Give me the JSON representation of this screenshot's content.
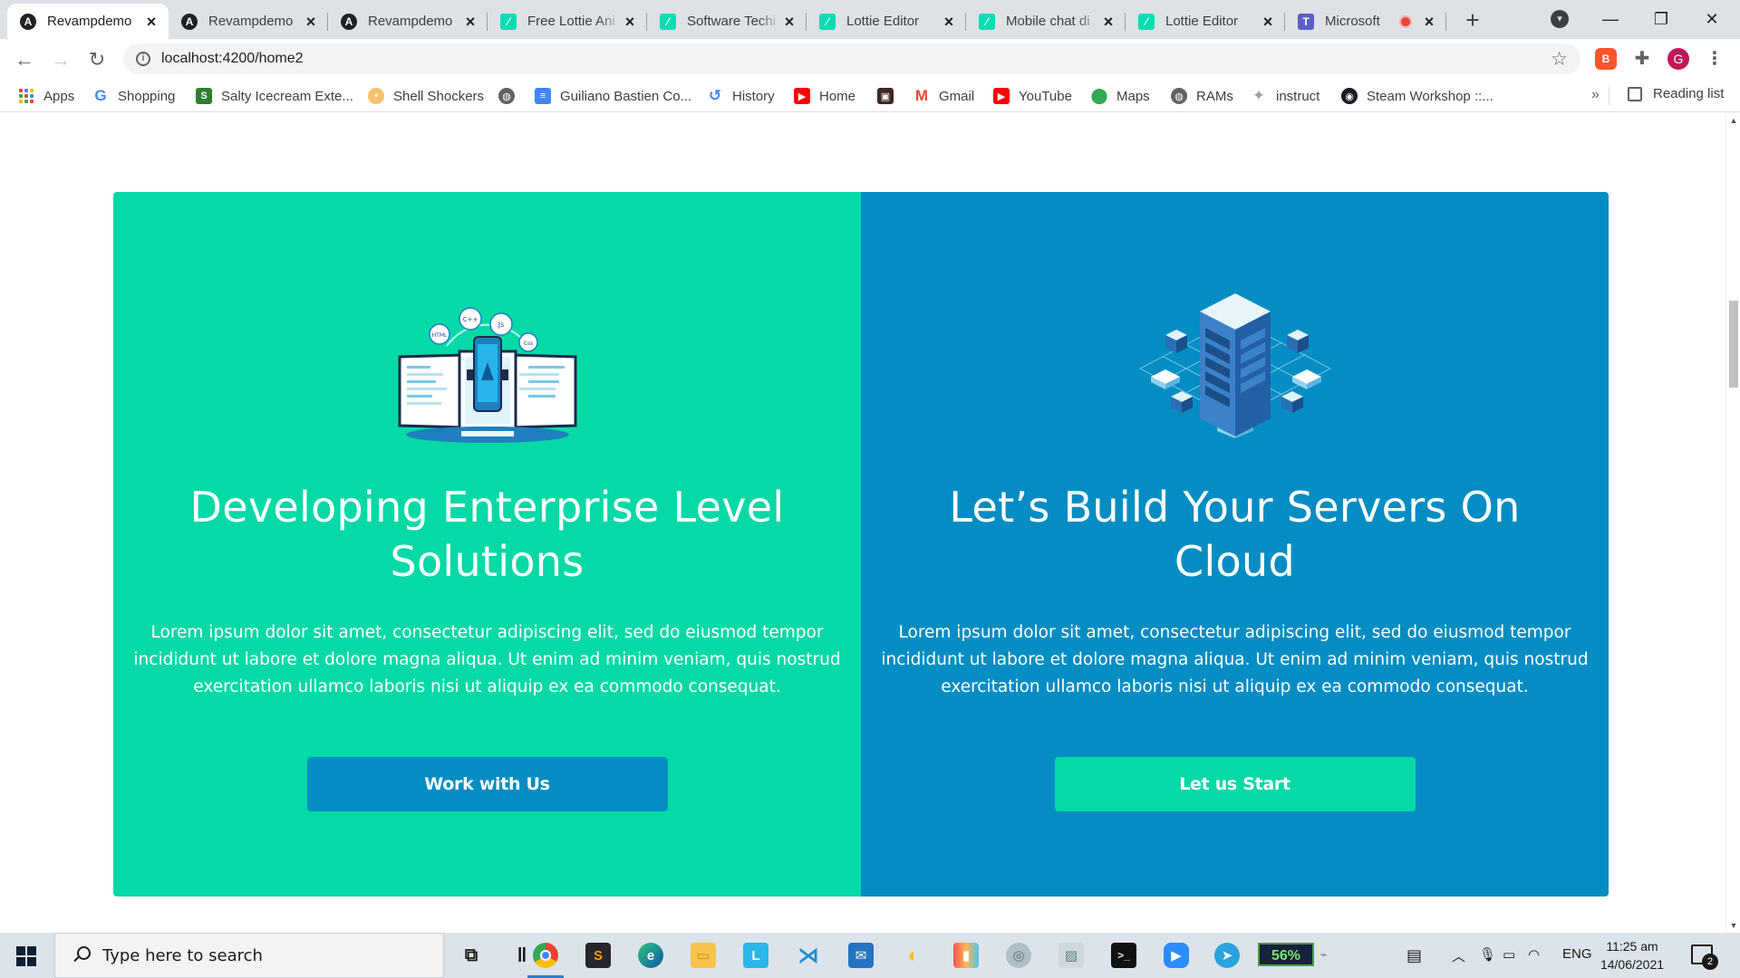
{
  "browser": {
    "tabs": [
      {
        "title": "Revampdemo",
        "favicon": "angular-icon",
        "active": true
      },
      {
        "title": "Revampdemo",
        "favicon": "angular-icon"
      },
      {
        "title": "Revampdemo",
        "favicon": "angular-icon"
      },
      {
        "title": "Free Lottie Ani",
        "favicon": "lottie-icon"
      },
      {
        "title": "Software Techi",
        "favicon": "lottie-icon"
      },
      {
        "title": "Lottie Editor",
        "favicon": "lottie-icon"
      },
      {
        "title": "Mobile chat di",
        "favicon": "lottie-icon"
      },
      {
        "title": "Lottie Editor",
        "favicon": "lottie-icon"
      },
      {
        "title": "Microsoft",
        "favicon": "teams-icon",
        "recording": true
      }
    ],
    "new_tab_glyph": "+",
    "window_controls": {
      "minimize": "—",
      "maximize": "❐",
      "close": "✕"
    },
    "address": "localhost:4200/home2",
    "profile_initial": "G",
    "bookmarks": [
      {
        "label": "Apps",
        "icon": "apps-grid-icon"
      },
      {
        "label": "Shopping",
        "icon": "google-icon"
      },
      {
        "label": "Salty Icecream Exte...",
        "icon": "salty-icon"
      },
      {
        "label": "Shell Shockers",
        "icon": "egg-icon"
      },
      {
        "label": "",
        "icon": "globe-icon"
      },
      {
        "label": "Guiliano Bastien Co...",
        "icon": "docs-icon"
      },
      {
        "label": "History",
        "icon": "history-icon"
      },
      {
        "label": "Home",
        "icon": "youtube-icon"
      },
      {
        "label": "",
        "icon": "image-icon"
      },
      {
        "label": "Gmail",
        "icon": "gmail-icon"
      },
      {
        "label": "YouTube",
        "icon": "youtube-icon"
      },
      {
        "label": "Maps",
        "icon": "maps-pin-icon"
      },
      {
        "label": "RAMs",
        "icon": "globe-icon"
      },
      {
        "label": "instruct",
        "icon": "feather-icon"
      },
      {
        "label": "Steam Workshop ::...",
        "icon": "steam-icon"
      }
    ],
    "more_bookmarks": "»",
    "reading_list": "Reading list"
  },
  "page": {
    "cards": [
      {
        "title": "Developing Enterprise Level Solutions",
        "body": "Lorem ipsum dolor sit amet, consectetur adipiscing elit, sed do eiusmod tempor incididunt ut labore et dolore magna aliqua. Ut enim ad minim veniam, quis nostrud exercitation ullamco laboris nisi ut aliquip ex ea commodo consequat.",
        "button": "Work with Us",
        "color": "#05d9a6",
        "illustration": "developer-monitors-illustration",
        "bubbles": [
          "HTML",
          "C++",
          "Js",
          "Css"
        ]
      },
      {
        "title": "Let’s Build Your Servers On Cloud",
        "body": "Lorem ipsum dolor sit amet, consectetur adipiscing elit, sed do eiusmod tempor incididunt ut labore et dolore magna aliqua. Ut enim ad minim veniam, quis nostrud exercitation ullamco laboris nisi ut aliquip ex ea commodo consequat.",
        "button": "Let us Start",
        "color": "#048dc3",
        "illustration": "cloud-server-illustration"
      }
    ]
  },
  "taskbar": {
    "search_placeholder": "Type here to search",
    "battery_percent": "56%",
    "language": "ENG",
    "time": "11:25 am",
    "date": "14/06/2021",
    "notification_count": "2"
  }
}
